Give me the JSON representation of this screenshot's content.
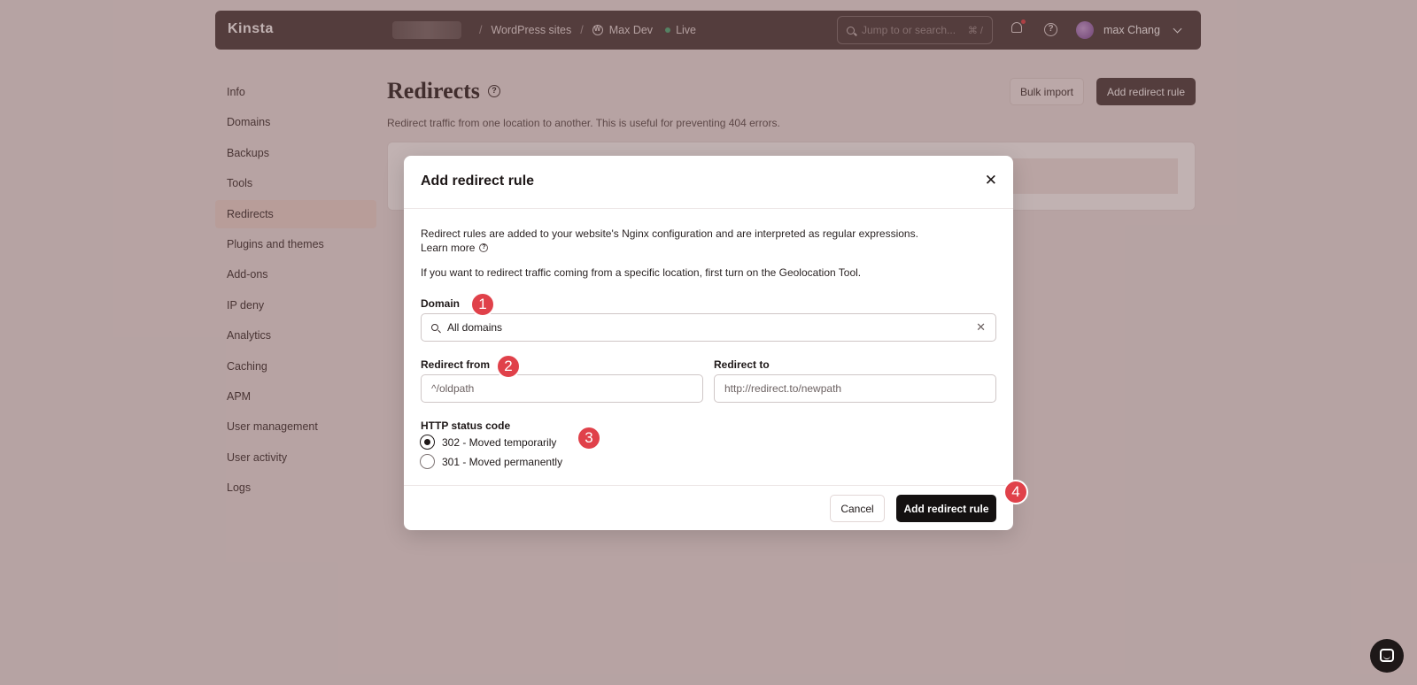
{
  "topbar": {
    "logo": "Kinsta",
    "breadcrumbs": [
      "WordPress sites",
      "Max Dev"
    ],
    "env": "Live",
    "search_placeholder": "Jump to or search...",
    "search_shortcut": "⌘ /",
    "user_name": "max Chang"
  },
  "sidebar": {
    "items": [
      {
        "label": "Info"
      },
      {
        "label": "Domains"
      },
      {
        "label": "Backups"
      },
      {
        "label": "Tools"
      },
      {
        "label": "Redirects"
      },
      {
        "label": "Plugins and themes"
      },
      {
        "label": "Add-ons"
      },
      {
        "label": "IP deny"
      },
      {
        "label": "Analytics"
      },
      {
        "label": "Caching"
      },
      {
        "label": "APM"
      },
      {
        "label": "User management"
      },
      {
        "label": "User activity"
      },
      {
        "label": "Logs"
      }
    ],
    "active_index": 4
  },
  "main": {
    "title": "Redirects",
    "description": "Redirect traffic from one location to another. This is useful for preventing 404 errors.",
    "bulk_import_label": "Bulk import",
    "add_rule_label": "Add redirect rule"
  },
  "modal": {
    "title": "Add redirect rule",
    "intro": "Redirect rules are added to your website's Nginx configuration and are interpreted as regular expressions.",
    "learn_more": "Learn more",
    "geo_note": "If you want to redirect traffic coming from a specific location, first turn on the Geolocation Tool.",
    "domain_label": "Domain",
    "domain_value": "All domains",
    "redirect_from_label": "Redirect from",
    "redirect_from_placeholder": "^/oldpath",
    "redirect_to_label": "Redirect to",
    "redirect_to_placeholder": "http://redirect.to/newpath",
    "status_label": "HTTP status code",
    "status_options": [
      {
        "label": "302 - Moved temporarily",
        "selected": true
      },
      {
        "label": "301 - Moved permanently",
        "selected": false
      }
    ],
    "cancel_label": "Cancel",
    "submit_label": "Add redirect rule"
  },
  "badges": [
    "1",
    "2",
    "3",
    "4"
  ],
  "colors": {
    "topbar": "#4a3d3d",
    "badge": "#e0414a",
    "primary_button": "#141111",
    "live_dot": "#4caf7d"
  }
}
